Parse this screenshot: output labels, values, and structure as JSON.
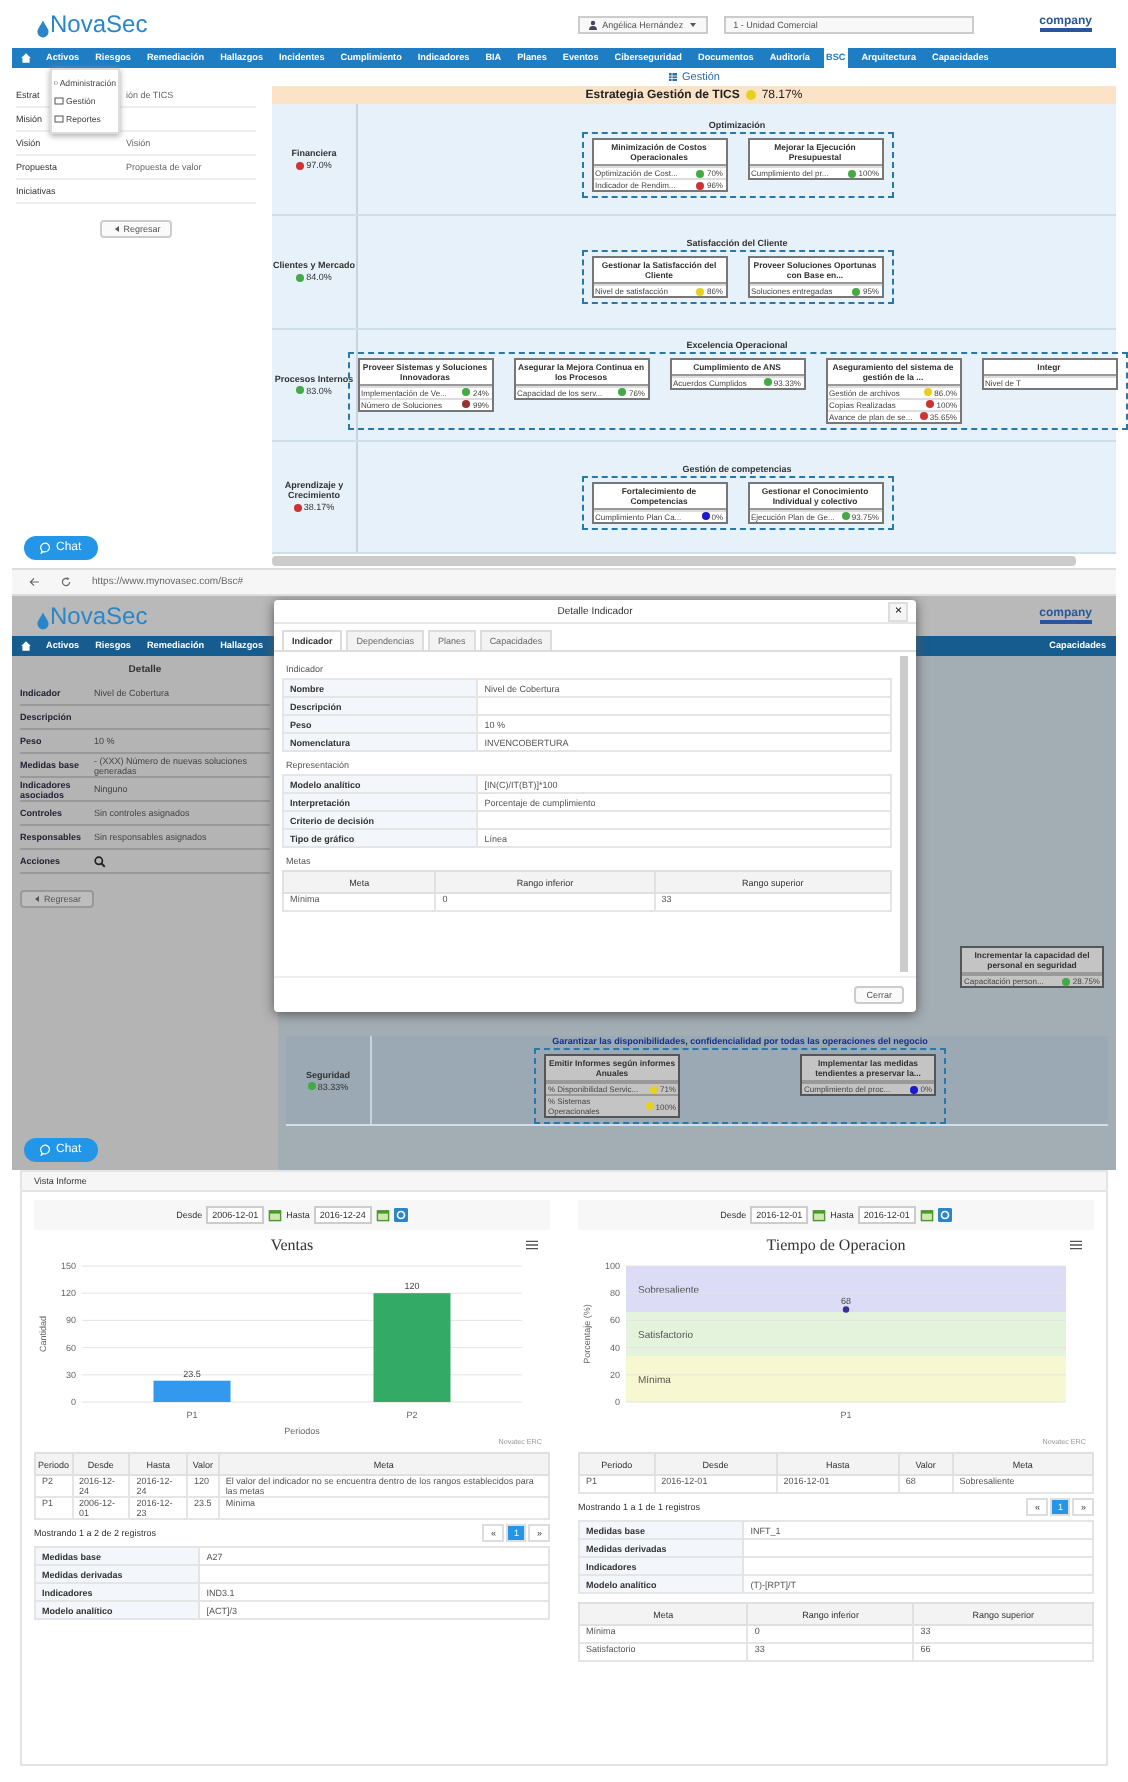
{
  "strategy_screen": {
    "header": {
      "logo": "NovaSec",
      "user_select": "Angélica Hernández",
      "unit_select": "1 - Unidad Comercial",
      "client_logo": "company"
    },
    "nav": [
      {
        "label": "Activos",
        "selected": false
      },
      {
        "label": "Riesgos",
        "selected": false
      },
      {
        "label": "Remediación",
        "selected": false
      },
      {
        "label": "Hallazgos",
        "selected": false
      },
      {
        "label": "Incidentes",
        "selected": false
      },
      {
        "label": "Cumplimiento",
        "selected": false
      },
      {
        "label": "Indicadores",
        "selected": false
      },
      {
        "label": "BIA",
        "selected": false
      },
      {
        "label": "Planes",
        "selected": false
      },
      {
        "label": "Eventos",
        "selected": false
      },
      {
        "label": "Ciberseguridad",
        "selected": false
      },
      {
        "label": "Documentos",
        "selected": false
      },
      {
        "label": "Auditoría",
        "selected": false
      },
      {
        "label": "BSC",
        "selected": true
      },
      {
        "label": "Arquitectura",
        "selected": false
      },
      {
        "label": "Capacidades",
        "selected": false
      }
    ],
    "dropdown_menu": [
      "Administración",
      "Gestión",
      "Reportes"
    ],
    "form": [
      {
        "label": "Estrat",
        "value": "ión de TICS"
      },
      {
        "label": "Misión"
      },
      {
        "label": "Visión",
        "value": "Visión"
      },
      {
        "label": "Propuesta",
        "value": "Propuesta de valor"
      },
      {
        "label": "Iniciativas"
      }
    ],
    "back_button": "Regresar",
    "section_title": "Gestión",
    "map": {
      "title": "Estrategia Gestión de TICS",
      "score": "78.17%",
      "color": "#e6d21e",
      "perspectives": [
        {
          "name": "Financiera",
          "score": "97.0%",
          "color": "#cc3333",
          "theme": "Optimización",
          "objectives": [
            {
              "title": "Minimización de Costos Operacionales",
              "indicators": [
                {
                  "name": "Optimización de Cost...",
                  "color": "#44aa44",
                  "value": "70%"
                },
                {
                  "name": "Indicador de Rendim...",
                  "color": "#cc3333",
                  "value": "96%"
                }
              ]
            },
            {
              "title": "Mejorar la Ejecución Presupuestal",
              "indicators": [
                {
                  "name": "Cumplimiento del pr...",
                  "color": "#44aa44",
                  "value": "100%"
                }
              ]
            }
          ]
        },
        {
          "name": "Clientes y Mercado",
          "score": "84.0%",
          "color": "#44aa44",
          "theme": "Satisfacción del Cliente",
          "objectives": [
            {
              "title": "Gestionar la Satisfacción del Cliente",
              "indicators": [
                {
                  "name": "Nivel de satisfacción",
                  "color": "#e6d21e",
                  "value": "86%"
                }
              ]
            },
            {
              "title": "Proveer Soluciones Oportunas con Base en...",
              "indicators": [
                {
                  "name": "Soluciones entregadas",
                  "color": "#44aa44",
                  "value": "95%"
                }
              ]
            }
          ]
        },
        {
          "name": "Procesos Internos",
          "score": "83.0%",
          "color": "#44aa44",
          "theme": "Excelencia Operacional",
          "objectives": [
            {
              "title": "Proveer Sistemas y Soluciones Innovadoras",
              "indicators": [
                {
                  "name": "Implementación de Ve...",
                  "color": "#44aa44",
                  "value": "24%"
                },
                {
                  "name": "Número de Soluciones",
                  "color": "#993333",
                  "value": "99%"
                }
              ]
            },
            {
              "title": "Asegurar la Mejora Continua en los Procesos",
              "indicators": [
                {
                  "name": "Capacidad de los serv...",
                  "color": "#44aa44",
                  "value": "76%"
                }
              ]
            },
            {
              "title": "Cumplimiento de ANS",
              "indicators": [
                {
                  "name": "Acuerdos Cumplidos",
                  "color": "#44aa44",
                  "value": "93.33%"
                }
              ]
            },
            {
              "title": "Aseguramiento del sistema de gestión de la ...",
              "indicators": [
                {
                  "name": "Gestión de archivos",
                  "color": "#e6d21e",
                  "value": "86.0%"
                },
                {
                  "name": "Copias Realizadas",
                  "color": "#cc3333",
                  "value": "100%"
                },
                {
                  "name": "Avance de plan de se...",
                  "color": "#cc3333",
                  "value": "35.65%"
                }
              ]
            },
            {
              "title": "Integr",
              "indicators": [
                {
                  "name": "Nivel de T"
                }
              ]
            }
          ]
        },
        {
          "name": "Aprendizaje y Crecimiento",
          "score": "38.17%",
          "color": "#cc3333",
          "theme": "Gestión de competencias",
          "objectives": [
            {
              "title": "Fortalecimiento de Competencias",
              "indicators": [
                {
                  "name": "Cumplimiento Plan Ca...",
                  "color": "#1a1acc",
                  "value": "0%"
                }
              ]
            },
            {
              "title": "Gestionar el Conocimiento Individual y colectivo",
              "indicators": [
                {
                  "name": "Ejecución Plan de Ge...",
                  "color": "#44aa44",
                  "value": "93.75%"
                }
              ]
            }
          ]
        }
      ]
    },
    "chat_button": "Chat"
  },
  "detail_screen": {
    "browser_url": "https://www.mynovasec.com/Bsc#",
    "header": {
      "logo": "NovaSec",
      "client_logo": "company"
    },
    "nav": [
      "Activos",
      "Riesgos",
      "Remediación",
      "Hallazgos",
      "Capacidades"
    ],
    "panel_title": "Detalle",
    "rows": [
      {
        "label": "Indicador",
        "value": "Nivel de Cobertura"
      },
      {
        "label": "Descripción"
      },
      {
        "label": "Peso",
        "value": "10 %"
      },
      {
        "label": "Medidas base",
        "value": "- (XXX) Número de nuevas soluciones generadas"
      },
      {
        "label": "Indicadores asociados",
        "value": "Ninguno"
      },
      {
        "label": "Controles",
        "value": "Sin controles asignados"
      },
      {
        "label": "Responsables",
        "value": "Sin responsables asignados"
      },
      {
        "label": "Acciones"
      }
    ],
    "back_button": "Regresar",
    "map_fragment": {
      "side_objective": {
        "title": "Incrementar la capacidad del personal en seguridad",
        "indicator": "Capacitación person...",
        "color": "#44aa44",
        "value": "28.75%"
      },
      "perspective": {
        "name": "Seguridad",
        "score": "83.33%",
        "color": "#44aa44"
      },
      "theme": "Garantizar las disponibilidades, confidencialidad por todas las operaciones del negocio",
      "objectives": [
        {
          "title": "Emitir Informes según informes Anuales",
          "indicators": [
            {
              "name": "% Disponibilidad Servic...",
              "color": "#e6d21e",
              "value": "71%"
            },
            {
              "name": "% Sistemas Operacionales",
              "color": "#e6d21e",
              "value": "100%"
            }
          ]
        },
        {
          "title": "Implementar las medidas tendientes a preservar la...",
          "indicators": [
            {
              "name": "Cumplimiento del proc...",
              "color": "#1a1acc",
              "value": "0%"
            }
          ]
        }
      ]
    },
    "chat_button": "Chat",
    "modal": {
      "title": "Detalle Indicador",
      "close": "×",
      "tabs": [
        {
          "label": "Indicador",
          "selected": true
        },
        {
          "label": "Dependencias",
          "selected": false
        },
        {
          "label": "Planes",
          "selected": false
        },
        {
          "label": "Capacidades",
          "selected": false
        }
      ],
      "sections": [
        {
          "title": "Indicador",
          "rows": [
            {
              "label": "Nombre",
              "value": "Nivel de Cobertura"
            },
            {
              "label": "Descripción"
            },
            {
              "label": "Peso",
              "value": "10 %"
            },
            {
              "label": "Nomenclatura",
              "value": "INVENCOBERTURA"
            }
          ]
        },
        {
          "title": "Representación",
          "rows": [
            {
              "label": "Modelo analítico",
              "value": "[IN(C)/IT(BT)]*100"
            },
            {
              "label": "Interpretación",
              "value": "Porcentaje de cumplimiento"
            },
            {
              "label": "Criterio de decisión"
            },
            {
              "label": "Tipo de gráfico",
              "value": "Línea"
            }
          ]
        }
      ],
      "goals_title": "Metas",
      "goals_columns": [
        "Meta",
        "Rango inferior",
        "Rango superior"
      ],
      "goals_rows": [
        [
          "Mínima",
          "0",
          "33"
        ]
      ],
      "close_button": "Cerrar"
    }
  },
  "report_screen": {
    "title": "Vista Informe",
    "panels": [
      {
        "from_label": "Desde",
        "from": "2006-12-01",
        "to_label": "Hasta",
        "to": "2016-12-24",
        "chart_data": {
          "type": "bar",
          "title": "Ventas",
          "xlabel": "Periodos",
          "ylabel": "Cantidad",
          "categories": [
            "P1",
            "P2"
          ],
          "series": [
            {
              "color": "#3399ee",
              "values": [
                23.5,
                null
              ]
            },
            {
              "color": "#33aa66",
              "values": [
                null,
                120
              ]
            }
          ],
          "ylim": [
            0,
            150
          ],
          "yticks": [
            0,
            30,
            60,
            90,
            120,
            150
          ],
          "grid": true,
          "data_labels": true
        },
        "credit": "Novatec ERC",
        "columns": [
          "Periodo",
          "Desde",
          "Hasta",
          "Valor",
          "Meta"
        ],
        "rows": [
          [
            "P2",
            "2016-12-24",
            "2016-12-24",
            "120",
            "El valor del indicador no se encuentra dentro de los rangos establecidos para las metas"
          ],
          [
            "P1",
            "2006-12-01",
            "2016-12-23",
            "23.5",
            "Mínima"
          ]
        ],
        "info": "Mostrando 1 a 2 de 2 registros",
        "pages": [
          {
            "label": "«",
            "selected": false
          },
          {
            "label": "1",
            "selected": true
          },
          {
            "label": "»",
            "selected": false
          }
        ],
        "details": [
          {
            "label": "Medidas base",
            "value": "A27"
          },
          {
            "label": "Medidas derivadas"
          },
          {
            "label": "Indicadores",
            "value": "IND3.1"
          },
          {
            "label": "Modelo analítico",
            "value": "[ACT]/3"
          }
        ]
      },
      {
        "from_label": "Desde",
        "from": "2016-12-01",
        "to_label": "Hasta",
        "to": "2016-12-01",
        "chart_data": {
          "type": "line",
          "title": "Tiempo de Operacion",
          "ylabel": "Porcentaje (%)",
          "categories": [
            "P1"
          ],
          "series": [
            {
              "color": "#333399",
              "marker": "circle",
              "values": [
                68
              ]
            }
          ],
          "ylim": [
            0,
            100
          ],
          "yticks": [
            0,
            20,
            40,
            60,
            80,
            100
          ],
          "grid": true,
          "data_labels": true
        },
        "zones": [
          {
            "label": "Sobresaliente",
            "color": "#dcdcf7"
          },
          {
            "label": "Satisfactorio",
            "color": "#e4f3dc"
          },
          {
            "label": "Mínima",
            "color": "#f7f7d2"
          }
        ],
        "credit": "Novatec ERC",
        "columns": [
          "Periodo",
          "Desde",
          "Hasta",
          "Valor",
          "Meta"
        ],
        "rows": [
          [
            "P1",
            "2016-12-01",
            "2016-12-01",
            "68",
            "Sobresaliente"
          ]
        ],
        "info": "Mostrando 1 a 1 de 1 registros",
        "pages": [
          {
            "label": "«",
            "selected": false
          },
          {
            "label": "1",
            "selected": true
          },
          {
            "label": "»",
            "selected": false
          }
        ],
        "details": [
          {
            "label": "Medidas base",
            "value": "INFT_1"
          },
          {
            "label": "Medidas derivadas"
          },
          {
            "label": "Indicadores"
          },
          {
            "label": "Modelo analítico",
            "value": "(T)-[RPT]/T"
          }
        ],
        "goals_columns": [
          "Meta",
          "Rango inferior",
          "Rango superior"
        ],
        "goals_rows": [
          [
            "Mínima",
            "0",
            "33"
          ],
          [
            "Satisfactorio",
            "33",
            "66"
          ]
        ]
      }
    ]
  }
}
